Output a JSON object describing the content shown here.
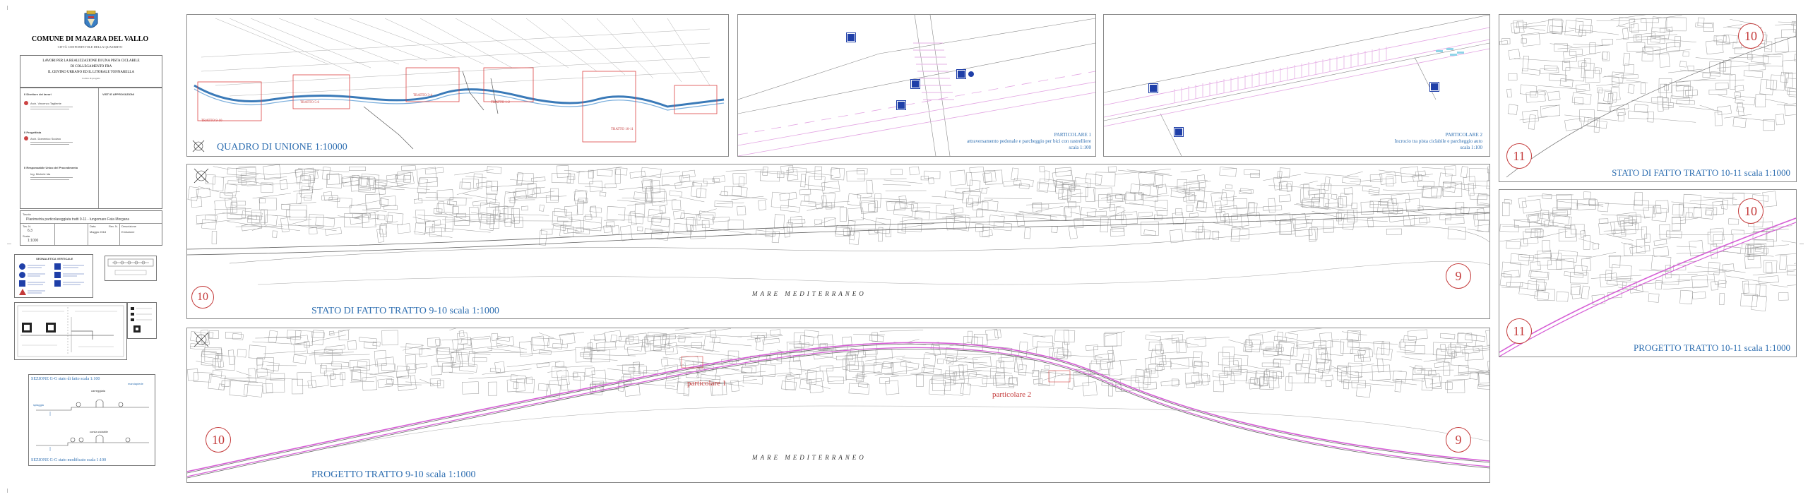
{
  "title_block": {
    "municipality": "COMUNE DI MAZARA DEL VALLO",
    "subtitle": "CITTÀ CONFORTEVOLE DELLA QUASIMITO",
    "project_lines": [
      "LAVORI PER LA REALIZZAZIONE DI UNA PISTA CICLABILE",
      "DI COLLEGAMENTO FRA",
      "IL CENTRO URBANO ED IL LITORALE TONNARELLA",
      "Codice di progetto"
    ],
    "col_left_title": "Il Direttore dei lavori",
    "col_right_title": "VISTI E APPROVAZIONI",
    "person_1": "Arch. Vincenzo Tagliente",
    "section_2": "Il Progettista",
    "person_2": "Arch. Domenico Scolaro",
    "section_3": "Il Responsabile Unico del Procedimento",
    "person_3": "Ing. Michele Ida",
    "table_header": "Tavola",
    "table_title": "Planimetria particolareggiata tratti 9-11 - lungomare Fata Morgana",
    "tav_label": "Tav. N.",
    "tav_value": "6.3",
    "scala_label": "Scala",
    "scala_value": "1:1000",
    "data_label": "Data",
    "data_value": "Maggio 2018",
    "rev_label": "Rev. N.",
    "rev_value": "Descrizione",
    "note": "Emissione"
  },
  "legend": {
    "title": "SEGNALETICA VERTICALE"
  },
  "sections": {
    "section_top_title": "SEZIONE G-G stato di fatto scala 1:100",
    "section_bottom_title": "SEZIONE G-G stato modificato scala 1:100",
    "label_marciapiede": "marciapiede",
    "label_carreggiata": "carreggiata",
    "label_corsia": "corsia ciclabile",
    "label_spiaggia": "spiaggia"
  },
  "panels": {
    "quadro_title": "QUADRO DI UNIONE 1:10000",
    "particolare1_title": "PARTICOLARE 1",
    "particolare1_desc": "attraversamento pedonale e parcheggio per bici con rastrelliere",
    "particolare1_scale": "scala 1:100",
    "particolare2_title": "PARTICOLARE 2",
    "particolare2_desc": "Incrocio tra pista ciclabile e parcheggio auto",
    "particolare2_scale": "scala 1:100",
    "stato_9_10": "STATO DI FATTO TRATTO 9-10 scala 1:1000",
    "progetto_9_10": "PROGETTO TRATTO 9-10 scala 1:1000",
    "stato_10_11": "STATO DI FATTO TRATTO 10-11 scala 1:1000",
    "progetto_10_11": "PROGETTO TRATTO 10-11 scala 1:1000",
    "sea_label": "MARE     MEDITERRANEO",
    "particolare_1_tag": "particolare 1",
    "particolare_2_tag": "particolare 2",
    "quadro_tags": [
      "TRATTO 9-10",
      "TRATTO 5-6",
      "TRATTO 3-4",
      "TRATTO 1-2",
      "TRATTO 10-11"
    ],
    "num_9": "9",
    "num_10": "10",
    "num_11": "11"
  },
  "colors": {
    "title_blue": "#2f6fb1",
    "number_red": "#c43a3a",
    "bike_path": "#d65fd6",
    "sign_blue": "#1f3fa8",
    "linework": "#7a7a7a"
  }
}
